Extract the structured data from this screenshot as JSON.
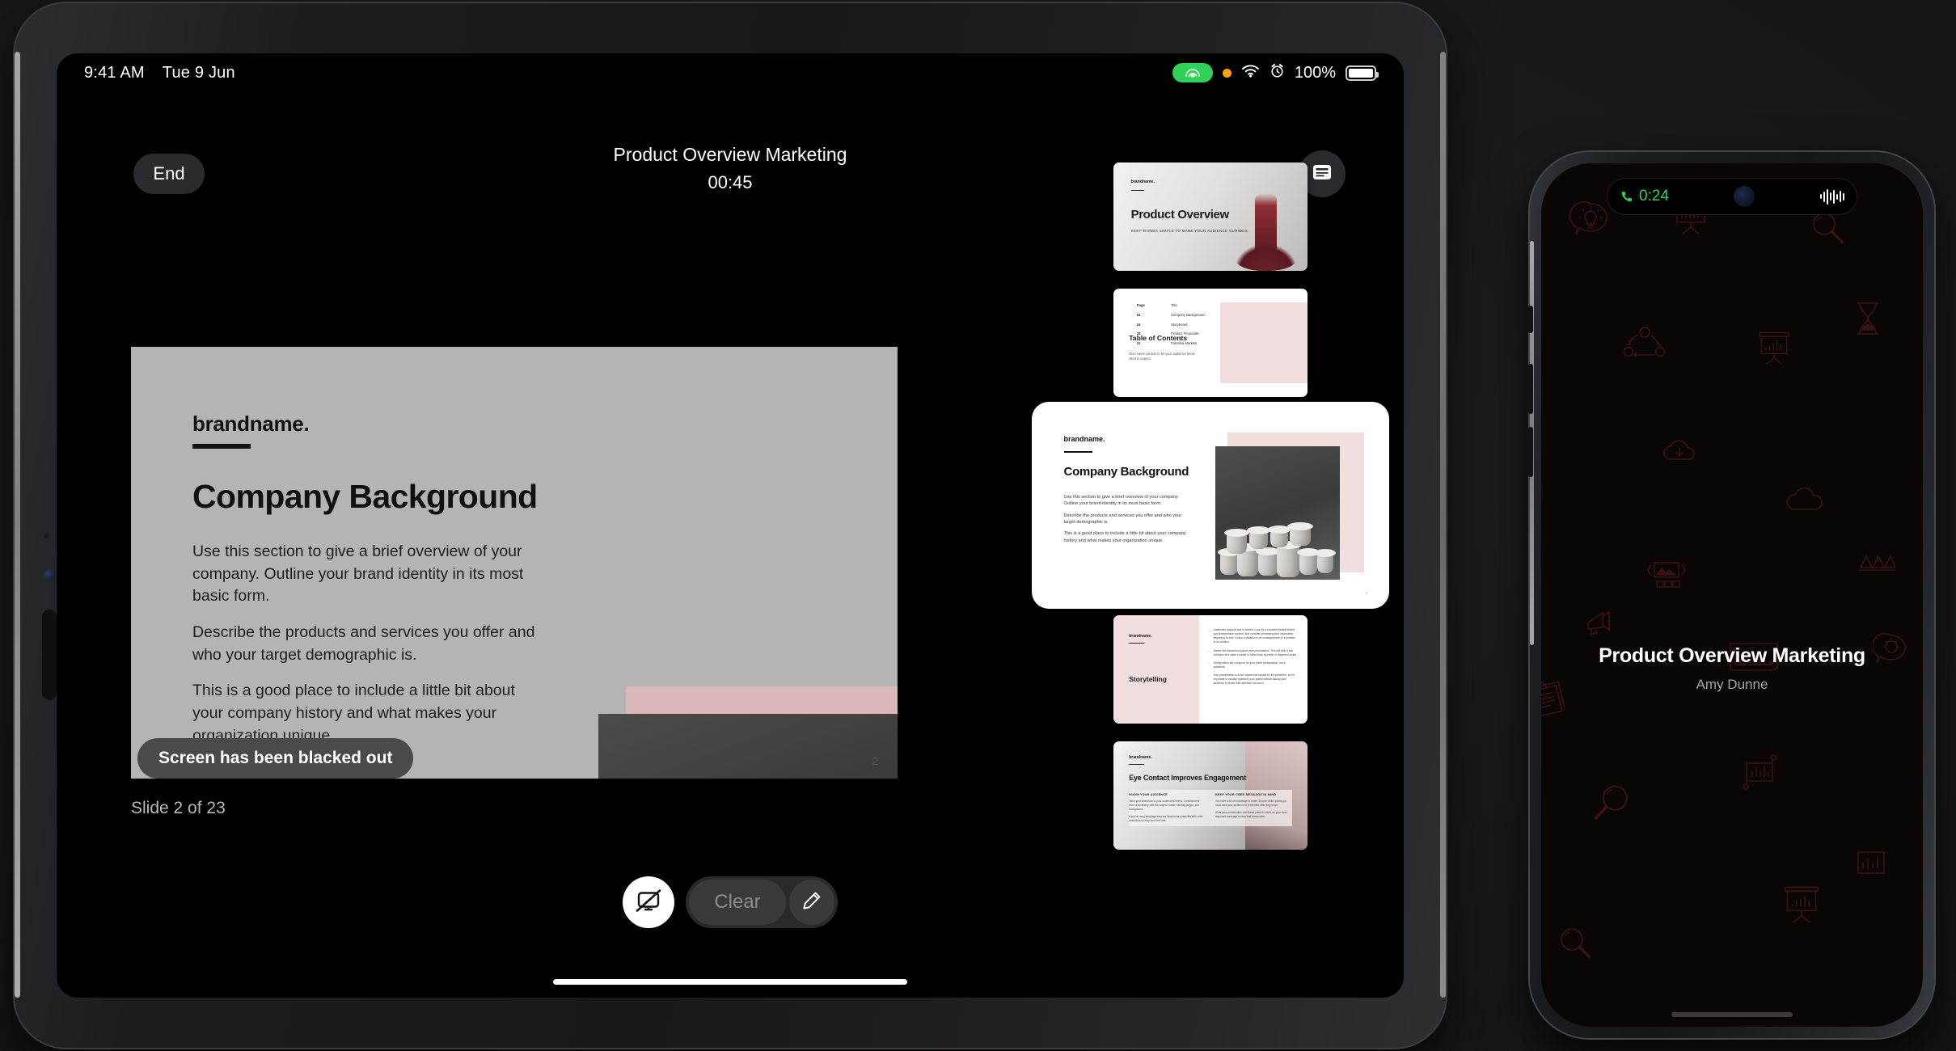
{
  "ipad": {
    "statusbar": {
      "time": "9:41 AM",
      "date": "Tue 9 Jun",
      "battery_percent": "100%",
      "share_icon": "screen-share-icon",
      "mic_icon": "mic-in-use-dot",
      "wifi_icon": "wifi-icon",
      "alarm_icon": "alarm-clock-icon",
      "battery_icon": "battery-icon"
    },
    "header": {
      "end_label": "End",
      "deck_title": "Product Overview Marketing",
      "timer": "00:45",
      "notes_icon": "presenter-notes-icon"
    },
    "slide": {
      "brand": "brandname.",
      "heading": "Company Background",
      "paragraphs": [
        "Use this section to give a brief overview of your company. Outline your brand identity in its most basic form.",
        "Describe the products and services you offer and who your target demographic is.",
        "This is a good place to include a little bit about your company history and what makes your organization unique."
      ],
      "page_number": "2"
    },
    "toast": "Screen has been blacked out",
    "slide_count": "Slide 2 of 23",
    "toolbar": {
      "blackout_icon": "screen-blackout-icon",
      "clear_label": "Clear",
      "pen_icon": "pencil-icon"
    },
    "thumbnails": [
      {
        "id": "slide-1",
        "active": false,
        "title": "Product Overview",
        "brand": "brandname.",
        "subtitle": "KEEP THINGS SIMPLE TO MAKE YOUR AUDIENCE CURIOUS."
      },
      {
        "id": "slide-2",
        "active": false,
        "title": "Table of Contents",
        "subtitle": "Give some context to let your audience know what to expect.",
        "toc": {
          "headers": [
            "Page",
            "Title"
          ],
          "rows": [
            [
              "04",
              "Company Background"
            ],
            [
              "15",
              "Storyboard"
            ],
            [
              "28",
              "Product Financials"
            ],
            [
              "22",
              "Potential Markets"
            ]
          ]
        }
      },
      {
        "id": "slide-3",
        "active": true,
        "brand": "brandname.",
        "title": "Company Background",
        "paragraphs": [
          "Use this section to give a brief overview of your company. Outline your brand identity in its most basic form.",
          "Describe the products and services you offer and who your target demographic is.",
          "This is a good place to include a little bit about your company history and what makes your organization unique."
        ],
        "page_number": "2"
      },
      {
        "id": "slide-4",
        "active": false,
        "brand": "brandname.",
        "title": "Storytelling",
        "bullets": [
          "Audiences respond well to stories. Look for a narrative thread behind your presentation content, and consider presenting your information beginning-to-end. Follow a situation to its consequences or a problem to its solution.",
          "Weave the thread throughout your presentation. This will help it feel cohesive and make it easier to follow than a jumble of disjointed slides.",
          "Strong slides are a support for your entire presentation, not a substitute.",
          "Your presentation is a live experience carried by the presenter, so it's important to visually represent your points without asking your audience to divide their attention too much."
        ]
      },
      {
        "id": "slide-5",
        "active": false,
        "brand": "brandname.",
        "title": "Eye Contact Improves Engagement",
        "columns": [
          {
            "heading": "KNOW YOUR AUDIENCE",
            "body": [
              "Tailor your slideshow to your audience's needs. Consider their level of familiarity with the subject matter, industry jargon, and background.",
              "If you're using language they are likely to be unfamiliar with, offer definitions so they don't feel lost."
            ]
          },
          {
            "heading": "KEEP YOUR CORE MESSAGE IN MIND",
            "body": [
              "You have a lot of knowledge to share. Decide which points you most want your audience to remember after they leave.",
              "Write your presentation with these points in mind, so your most important message is clear and memorable."
            ]
          }
        ]
      }
    ]
  },
  "iphone": {
    "island": {
      "call_timer": "0:24",
      "phone_icon": "phone-call-icon",
      "camera_icon": "front-camera-icon",
      "waveform_icon": "audio-waveform-icon"
    },
    "title": "Product Overview Marketing",
    "presenter": "Amy Dunne"
  },
  "colors": {
    "accent_green": "#30d158",
    "mic_orange": "#ff9f0a",
    "slide_pink": "#f2dede",
    "doodle_red": "#3a1212",
    "slide_bg": "#b4b4b4"
  }
}
